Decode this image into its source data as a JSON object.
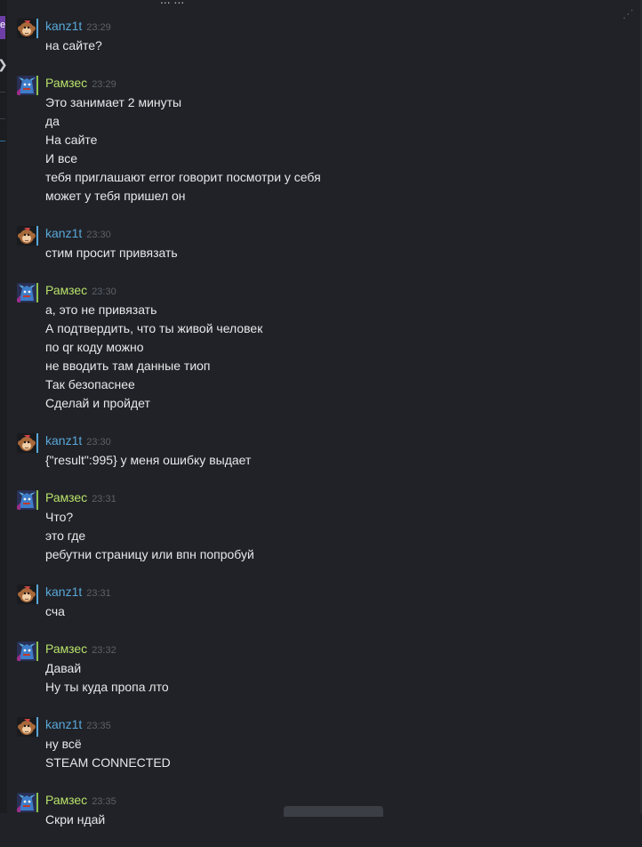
{
  "top_cut_text": "... ...",
  "chat": {
    "messages": [
      {
        "author": "kanz1t",
        "time": "23:29",
        "avatar": "monkey-avatar",
        "color": "blue",
        "lines": [
          "на сайте?"
        ]
      },
      {
        "author": "Рамзес",
        "time": "23:29",
        "avatar": "dragon-avatar",
        "color": "green",
        "lines": [
          "Это занимает 2 минуты",
          "да",
          "На сайте",
          "И все",
          "тебя приглашают error говорит посмотри у себя",
          "может у тебя пришел он"
        ]
      },
      {
        "author": "kanz1t",
        "time": "23:30",
        "avatar": "monkey-avatar",
        "color": "blue",
        "lines": [
          "стим просит привязать"
        ]
      },
      {
        "author": "Рамзес",
        "time": "23:30",
        "avatar": "dragon-avatar",
        "color": "green",
        "lines": [
          "а, это не привязать",
          "А подтвердить, что ты живой человек",
          "по qr коду можно",
          "не вводить там данные тиоп",
          "Так безопаснее",
          "Сделай и пройдет"
        ]
      },
      {
        "author": "kanz1t",
        "time": "23:30",
        "avatar": "monkey-avatar",
        "color": "blue",
        "lines": [
          "{\"result\":995} у меня ошибку выдает"
        ]
      },
      {
        "author": "Рамзес",
        "time": "23:31",
        "avatar": "dragon-avatar",
        "color": "green",
        "lines": [
          "Что?",
          "это где",
          "ребутни страницу или впн попробуй"
        ]
      },
      {
        "author": "kanz1t",
        "time": "23:31",
        "avatar": "monkey-avatar",
        "color": "blue",
        "lines": [
          "сча"
        ]
      },
      {
        "author": "Рамзес",
        "time": "23:32",
        "avatar": "dragon-avatar",
        "color": "green",
        "lines": [
          "Давай",
          "Ну ты куда пропа лто"
        ]
      },
      {
        "author": "kanz1t",
        "time": "23:35",
        "avatar": "monkey-avatar",
        "color": "blue",
        "lines": [
          "ну всё",
          "STEAM CONNECTED"
        ]
      },
      {
        "author": "Рамзес",
        "time": "23:35",
        "avatar": "dragon-avatar",
        "color": "green",
        "lines": [
          "Скри ндай"
        ]
      }
    ]
  },
  "colors": {
    "background": "#202227",
    "author_blue": "#59a7d8",
    "author_green": "#b8e06a",
    "timestamp": "#5c6068",
    "message_text": "#e6e8ea"
  }
}
